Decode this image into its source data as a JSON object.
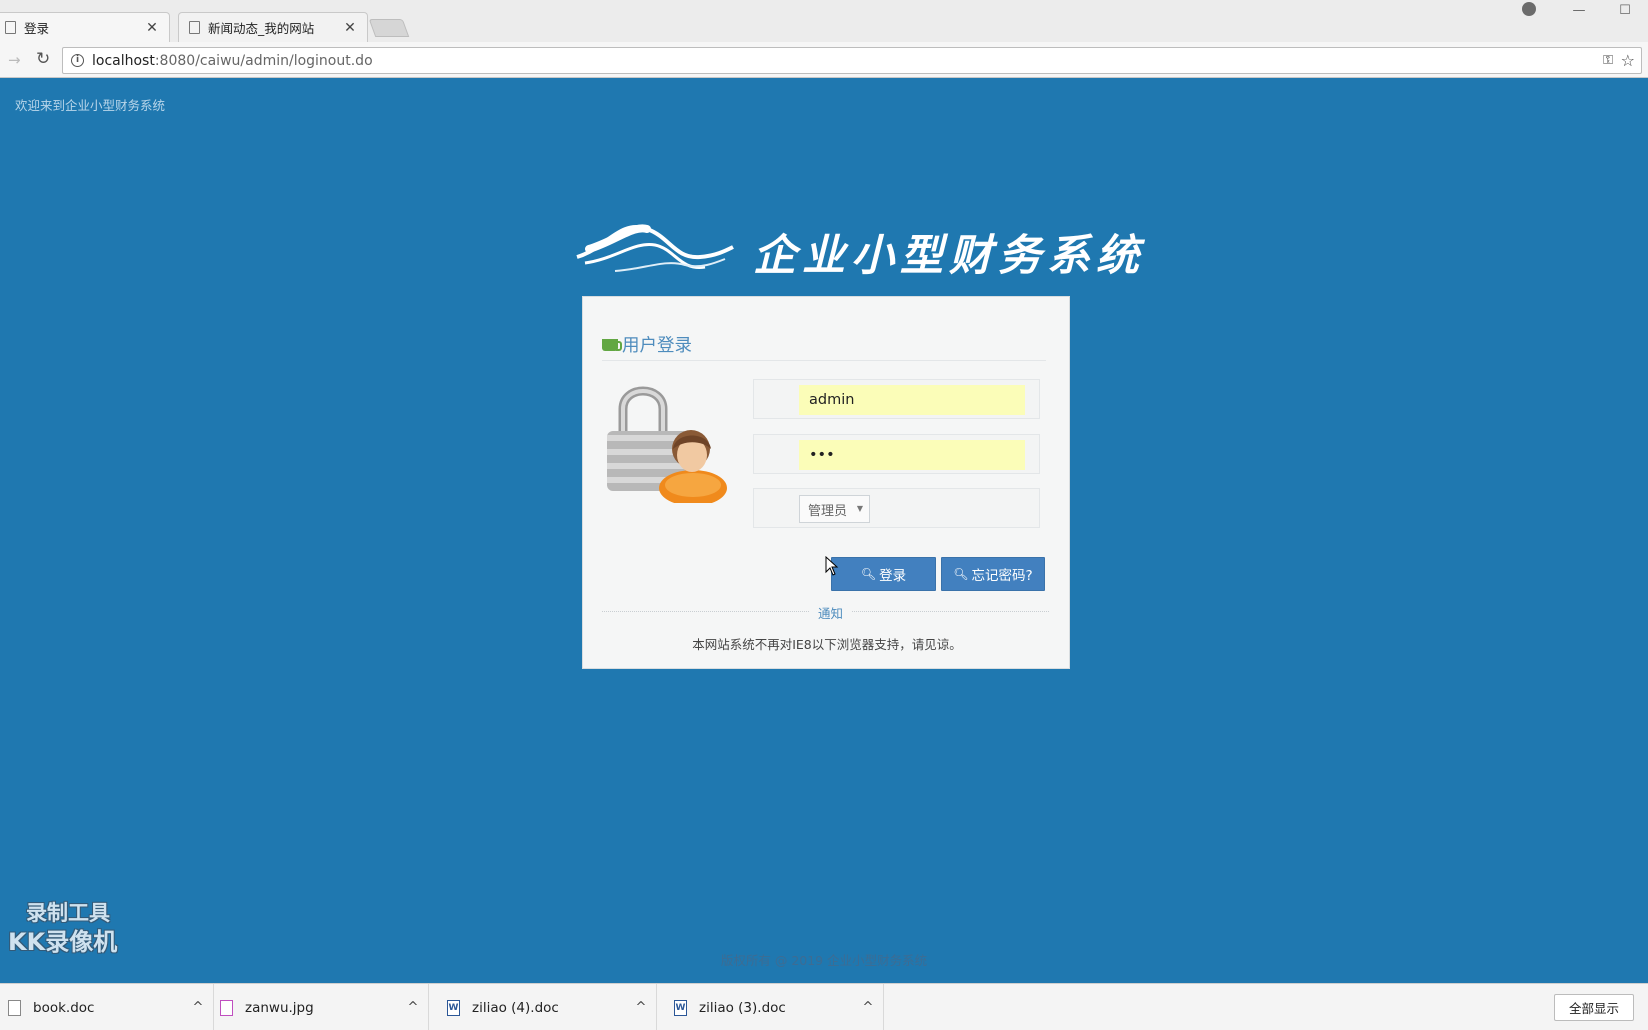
{
  "browser": {
    "tabs": [
      {
        "title": "登录",
        "active": true
      },
      {
        "title": "新闻动态_我的网站",
        "active": false
      }
    ],
    "url_host": "localhost",
    "url_rest": ":8080/caiwu/admin/loginout.do",
    "win_minimize": "—",
    "win_maximize": "☐"
  },
  "page": {
    "welcome": "欢迎来到企业小型财务系统",
    "logo_title": "企业小型财务系统",
    "login": {
      "title": "用户登录",
      "username": "admin",
      "password": "•••",
      "role": "管理员",
      "login_button": "登录",
      "forget_button": "忘记密码?",
      "notice_label": "通知",
      "notice_text": "本网站系统不再对IE8以下浏览器支持，请见谅。"
    },
    "watermark_line1": "录制工具",
    "watermark_line2": "KK录像机",
    "copyright": "版权所有 @ 2019 企业小型财务系统"
  },
  "downloads": {
    "items": [
      {
        "name": "book.doc",
        "type": "doc"
      },
      {
        "name": "zanwu.jpg",
        "type": "image"
      },
      {
        "name": "ziliao (4).doc",
        "type": "word"
      },
      {
        "name": "ziliao (3).doc",
        "type": "word"
      }
    ],
    "show_all": "全部显示"
  },
  "colors": {
    "page_bg": "#1f78b0",
    "button": "#4280bf",
    "input_autofill": "#fbfdb8",
    "accent_text": "#4e8cbd"
  }
}
